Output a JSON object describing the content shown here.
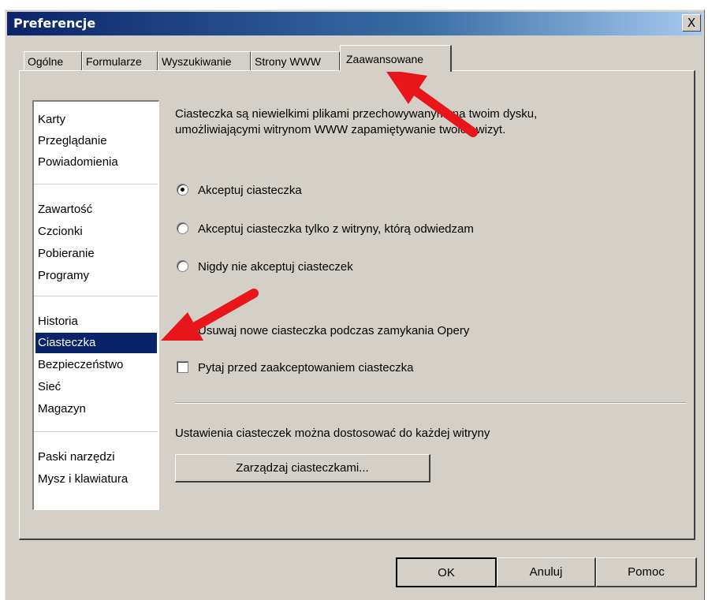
{
  "window": {
    "title": "Preferencje",
    "close_label": "X"
  },
  "tabs": [
    {
      "label": "Ogólne"
    },
    {
      "label": "Formularze"
    },
    {
      "label": "Wyszukiwanie"
    },
    {
      "label": "Strony WWW"
    },
    {
      "label": "Zaawansowane",
      "active": true
    }
  ],
  "sidebar": {
    "groups": [
      [
        "Karty",
        "Przeglądanie",
        "Powiadomienia"
      ],
      [
        "Zawartość",
        "Czcionki",
        "Pobieranie",
        "Programy"
      ],
      [
        "Historia",
        "Ciasteczka",
        "Bezpieczeństwo",
        "Sieć",
        "Magazyn"
      ],
      [
        "Paski narzędzi",
        "Mysz i klawiatura"
      ]
    ],
    "selected": "Ciasteczka"
  },
  "content": {
    "description_line1": "Ciasteczka są niewielkimi plikami przechowywanymi na twoim dysku,",
    "description_line2": "umożliwiającymi witrynom WWW zapamiętywanie twoich wizyt.",
    "radio_accept": "Akceptuj ciasteczka",
    "radio_accept_site_only": "Akceptuj ciasteczka tylko z witryny, którą odwiedzam",
    "radio_never": "Nigdy nie akceptuj ciasteczek",
    "check_delete_new": "Usuwaj nowe ciasteczka podczas zamykania Opery",
    "check_ask": "Pytaj przed zaakceptowaniem ciasteczka",
    "site_settings_text": "Ustawienia ciasteczek można dostosować do każdej witryny",
    "manage_button": "Zarządzaj ciasteczkami..."
  },
  "footer": {
    "ok": "OK",
    "cancel": "Anuluj",
    "help": "Pomoc"
  },
  "colors": {
    "selection": "#0a246a",
    "arrow": "#e8151b",
    "dialog": "#d4d0c8"
  }
}
